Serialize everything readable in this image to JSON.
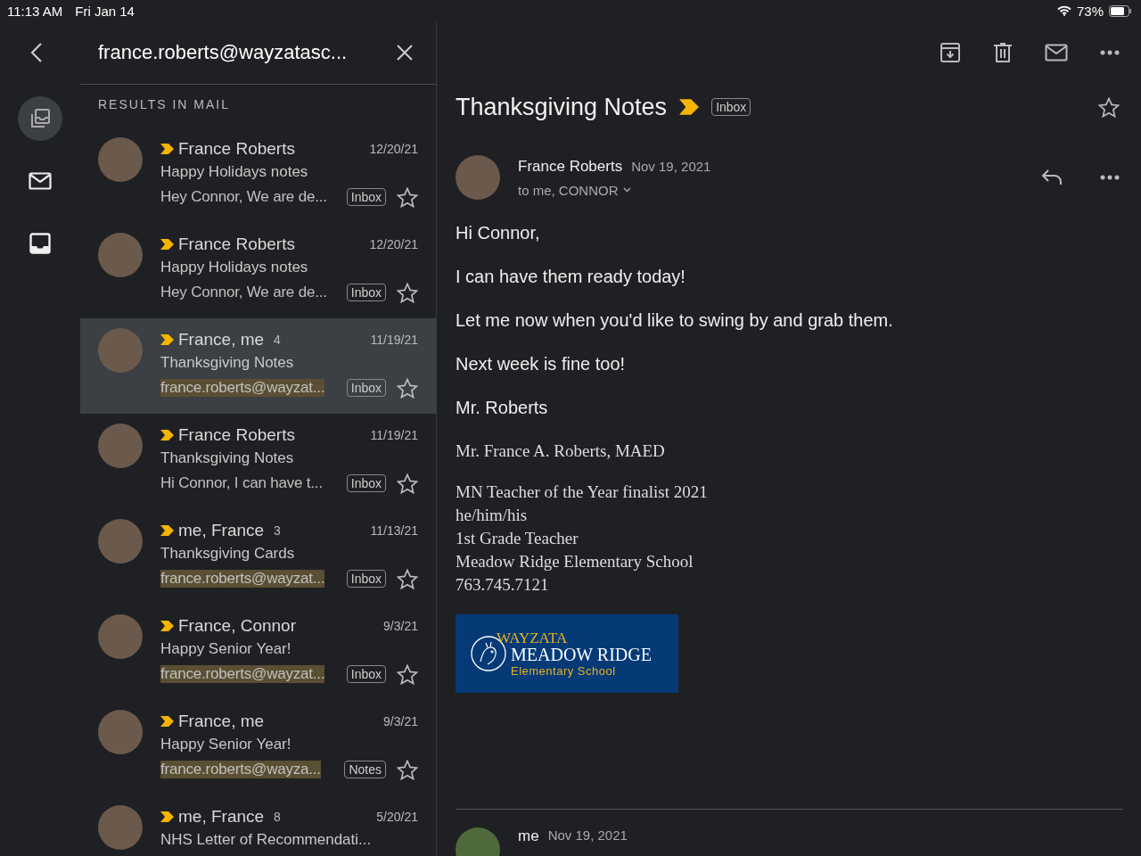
{
  "status_bar": {
    "time": "11:13 AM",
    "date": "Fri Jan 14",
    "battery": "73%"
  },
  "search": {
    "query": "france.roberts@wayzatasc..."
  },
  "rail": [
    {
      "kind": "stack",
      "selected": true
    },
    {
      "kind": "mail",
      "selected": false
    },
    {
      "kind": "inbox",
      "selected": false
    }
  ],
  "results_heading": "RESULTS IN MAIL",
  "results": [
    {
      "sender": "France Roberts",
      "date": "12/20/21",
      "subject": "Happy Holidays notes",
      "snippet": "Hey Connor, We are de...",
      "snippet_highlighted": false,
      "label": "Inbox",
      "selected": false
    },
    {
      "sender": "France Roberts",
      "date": "12/20/21",
      "subject": "Happy Holidays notes",
      "snippet": "Hey Connor, We are de...",
      "snippet_highlighted": false,
      "label": "Inbox",
      "selected": false
    },
    {
      "sender": "France, me",
      "count": "4",
      "date": "11/19/21",
      "subject": "Thanksgiving Notes",
      "snippet": "france.roberts@wayzat...",
      "snippet_highlighted": true,
      "label": "Inbox",
      "selected": true
    },
    {
      "sender": "France Roberts",
      "date": "11/19/21",
      "subject": "Thanksgiving Notes",
      "snippet": "Hi Connor, I can have t...",
      "snippet_highlighted": false,
      "label": "Inbox",
      "selected": false
    },
    {
      "sender": "me, France",
      "count": "3",
      "date": "11/13/21",
      "subject": "Thanksgiving Cards",
      "snippet": "france.roberts@wayzat...",
      "snippet_highlighted": true,
      "label": "Inbox",
      "selected": false
    },
    {
      "sender": "France, Connor",
      "date": "9/3/21",
      "subject": "Happy Senior Year!",
      "snippet": "france.roberts@wayzat...",
      "snippet_highlighted": true,
      "label": "Inbox",
      "selected": false
    },
    {
      "sender": "France, me",
      "date": "9/3/21",
      "subject": "Happy Senior Year!",
      "snippet": "france.roberts@wayza...",
      "snippet_highlighted": true,
      "label": "Notes",
      "selected": false
    },
    {
      "sender": "me, France",
      "count": "8",
      "date": "5/20/21",
      "subject": "NHS Letter of Recommendati...",
      "selected": false
    }
  ],
  "email": {
    "subject": "Thanksgiving Notes",
    "label": "Inbox",
    "from": "France Roberts",
    "date": "Nov 19, 2021",
    "to": "to me, CONNOR",
    "body": [
      "Hi Connor,",
      "I can have them ready today!",
      "Let me now when you'd like to swing by and grab them.",
      "Next week is fine too!",
      "Mr. Roberts"
    ],
    "signature": [
      "Mr. France A. Roberts, MAED"
    ],
    "signature_block": [
      "MN Teacher of the Year finalist 2021",
      "he/him/his",
      "1st Grade Teacher",
      "Meadow Ridge Elementary School",
      "763.745.7121"
    ],
    "logo": {
      "top": "WAYZATA",
      "name": "MEADOW RIDGE",
      "sub": "Elementary School"
    }
  },
  "next_message": {
    "from": "me",
    "date": "Nov 19, 2021"
  }
}
